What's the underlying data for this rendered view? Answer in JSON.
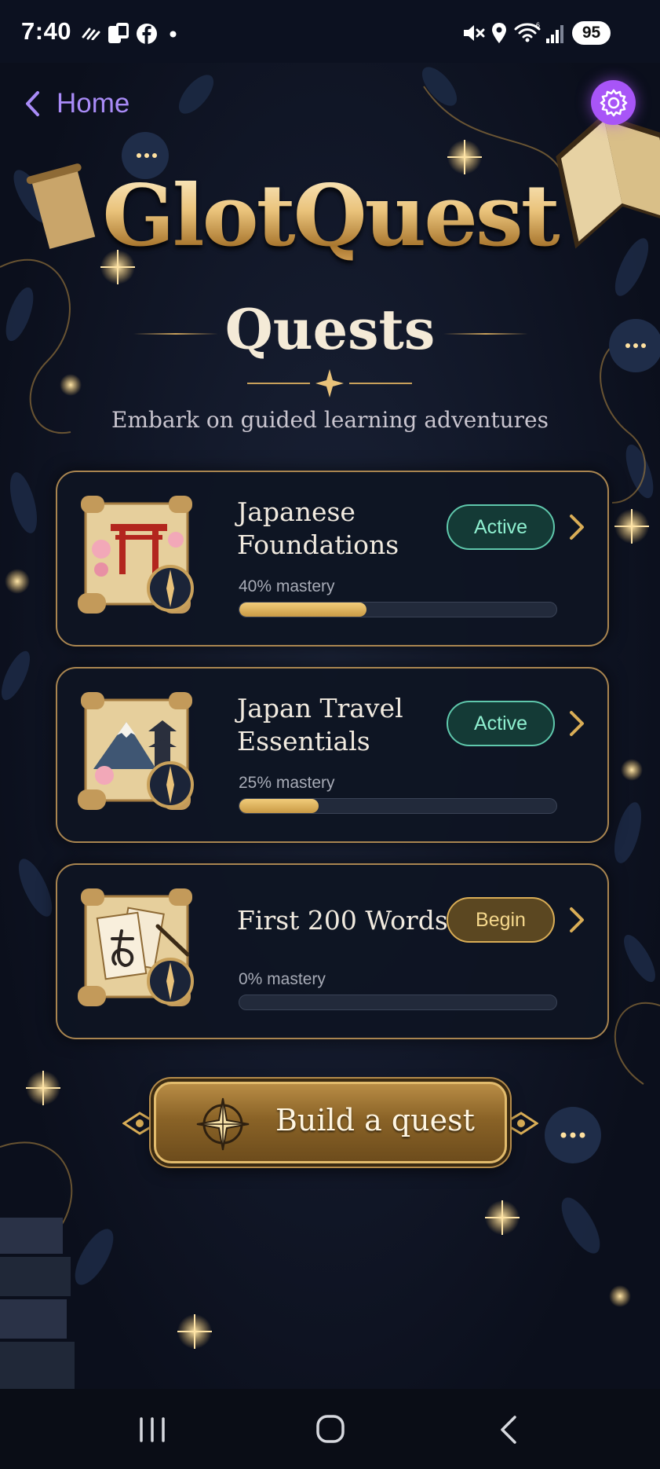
{
  "status_bar": {
    "time": "7:40",
    "battery": "95",
    "icons": [
      "wifi-calling-icon",
      "phone-update-icon",
      "facebook-icon",
      "notification-dot-icon",
      "mute-icon",
      "location-icon",
      "wifi-icon",
      "signal-icon"
    ]
  },
  "header": {
    "back_label": "Home",
    "back_icon": "chevron-left-icon",
    "settings_icon": "gear-icon"
  },
  "logo": "GlotQuest",
  "title": "Quests",
  "subtitle": "Embark on guided learning adventures",
  "quests": [
    {
      "title_line1": "Japanese",
      "title_line2": "Foundations",
      "status": "Active",
      "mastery_label": "40% mastery",
      "mastery": 0.4,
      "icon": "torii-scroll-icon"
    },
    {
      "title_line1": "Japan Travel",
      "title_line2": "Essentials",
      "status": "Active",
      "mastery_label": "25% mastery",
      "mastery": 0.25,
      "icon": "mount-fuji-scroll-icon"
    },
    {
      "title_line1": "First 200 Words",
      "title_line2": "",
      "status": "Begin",
      "mastery_label": "0% mastery",
      "mastery": 0.0,
      "icon": "hiragana-cards-scroll-icon"
    }
  ],
  "build_button": {
    "label": "Build a quest",
    "icon": "compass-rose-icon"
  },
  "colors": {
    "accent_purple": "#a855f7",
    "gold": "#d9ad56",
    "active_green": "#5fc8ac",
    "background": "#0b0f1c"
  },
  "nav": [
    "recent-apps-icon",
    "home-icon",
    "back-icon"
  ]
}
